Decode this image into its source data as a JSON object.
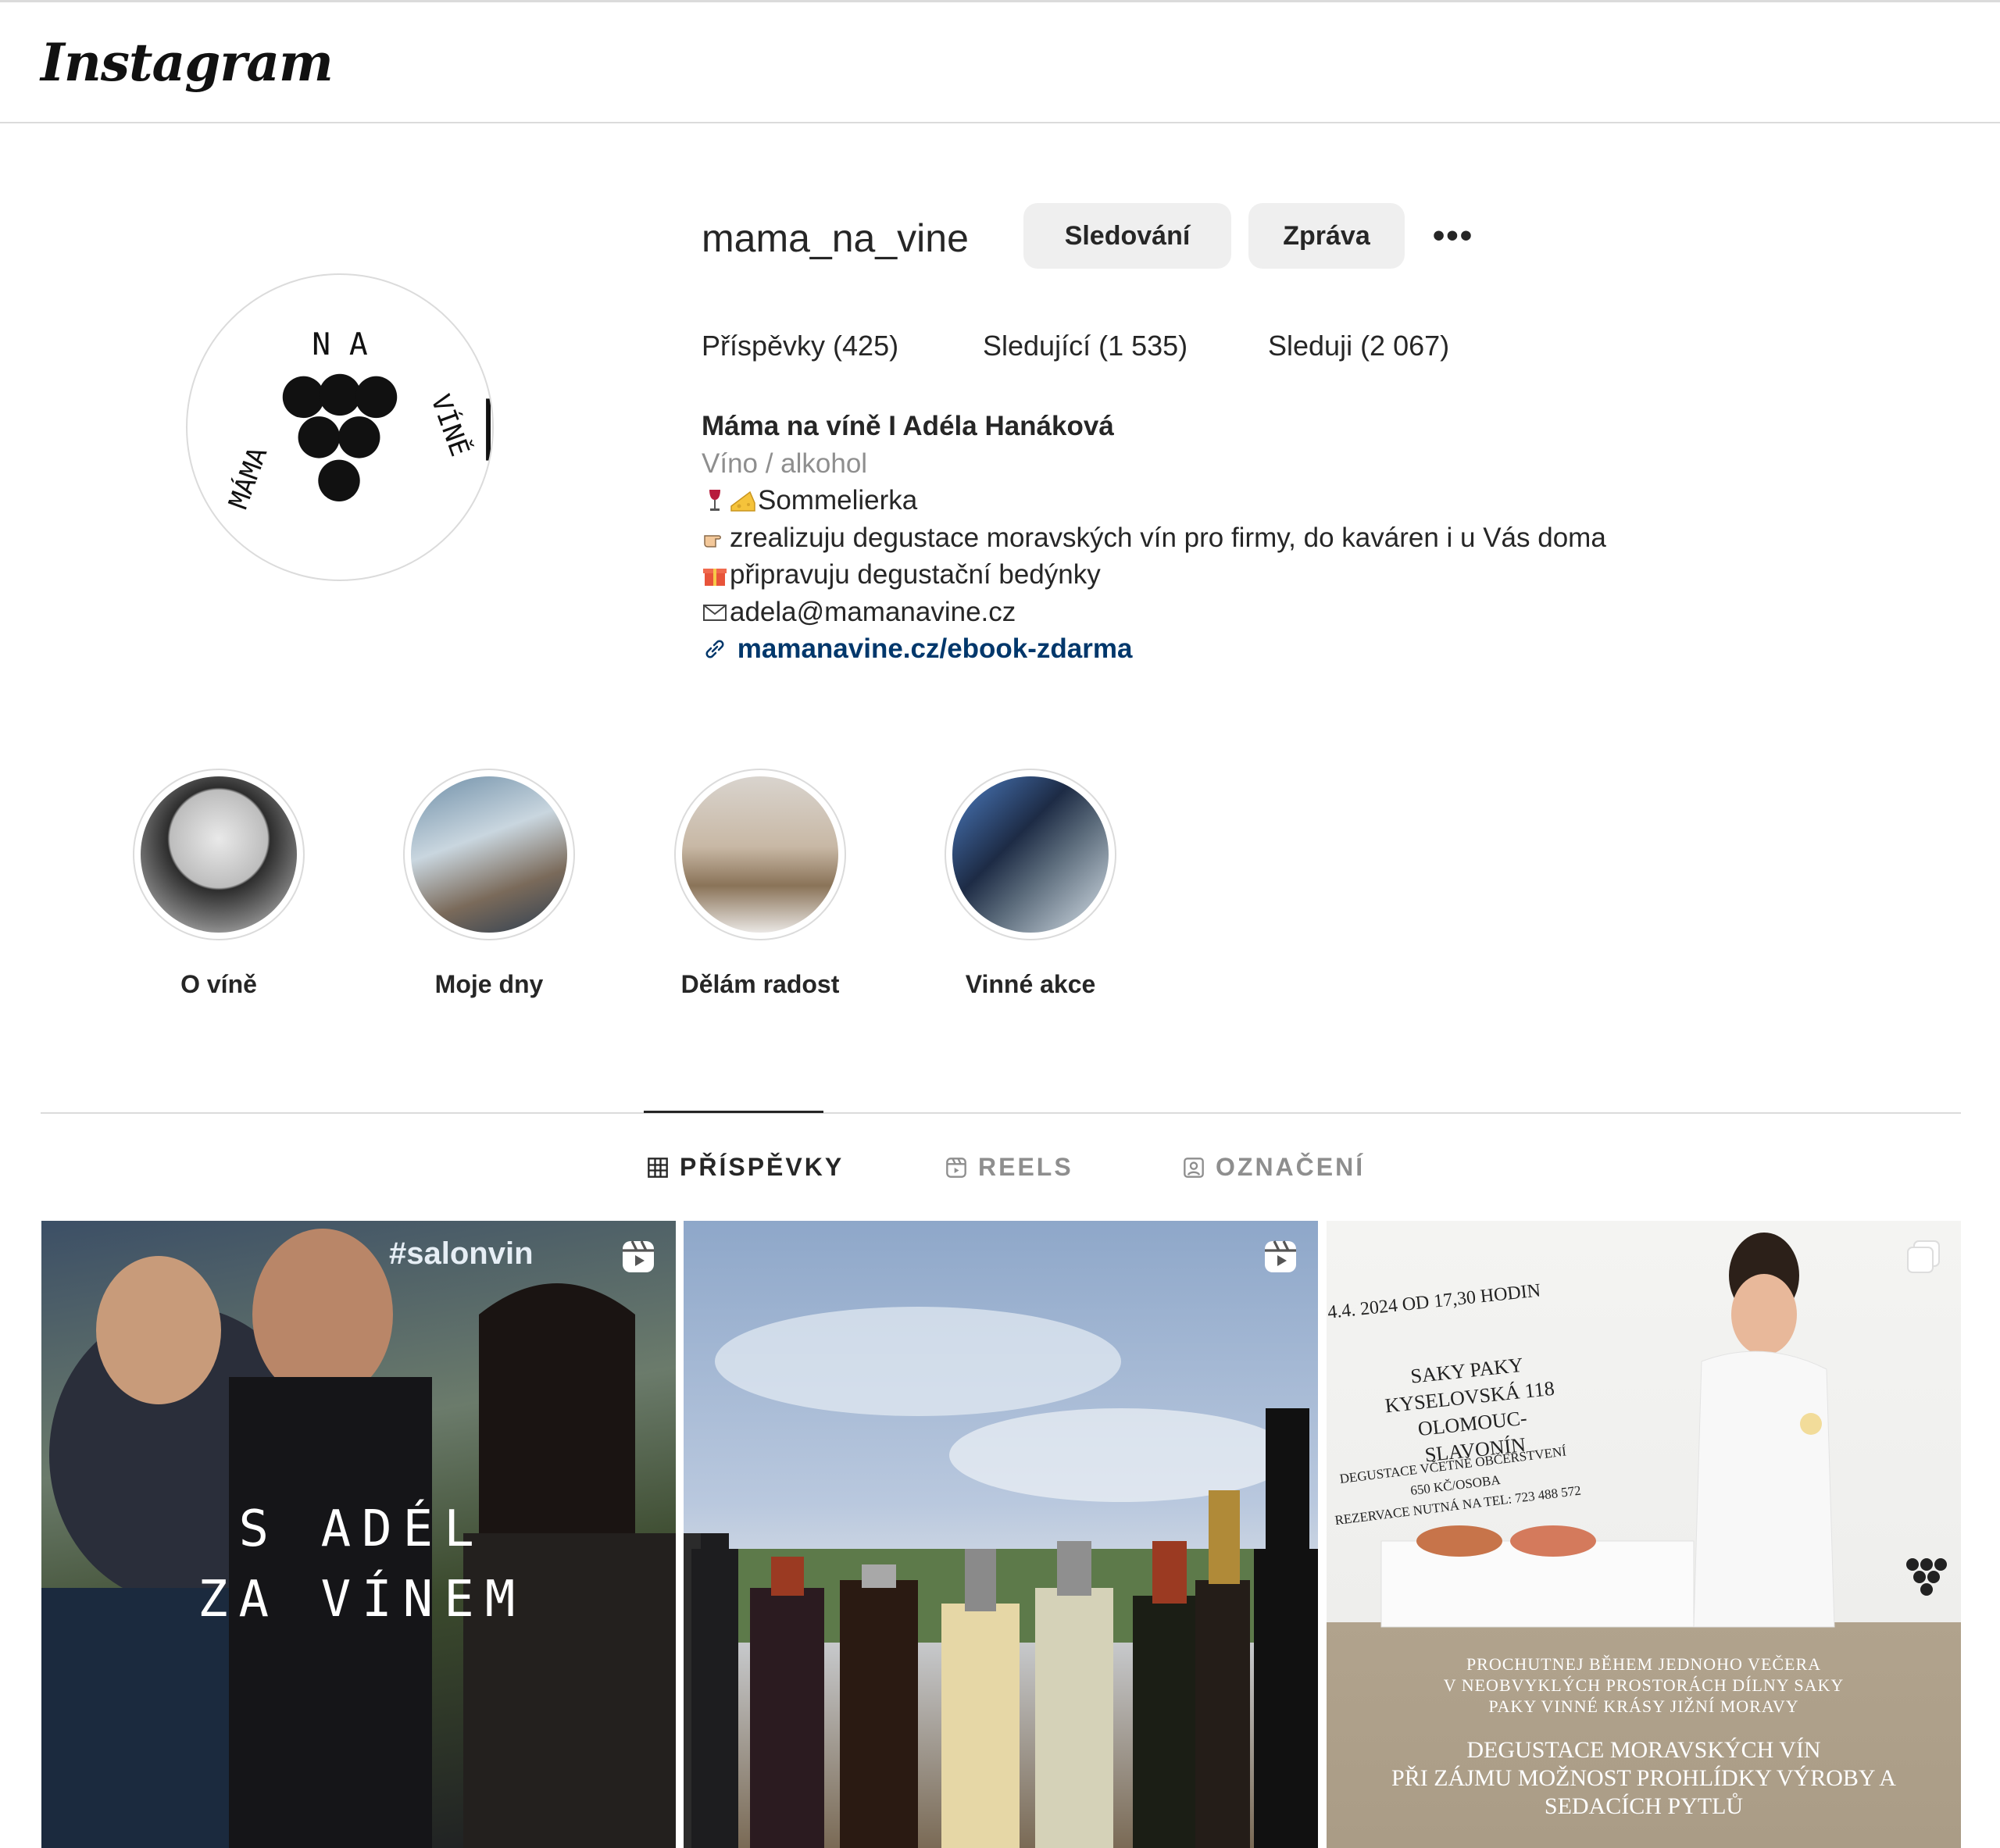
{
  "app": {
    "logo": "Instagram"
  },
  "profile": {
    "username": "mama_na_vine",
    "follow_button": "Sledování",
    "message_button": "Zpráva",
    "more_label": "•••",
    "stats": {
      "posts": "Příspěvky (425)",
      "followers": "Sledující (1 535)",
      "following": "Sleduji (2 067)"
    },
    "bio": {
      "name": "Máma na víně I Adéla Hanáková",
      "category": "Víno / alkohol",
      "line1": "Sommelierka",
      "line2": "zrealizuju degustace moravských vín pro firmy, do kaváren i u Vás doma",
      "line3": "připravuju degustační bedýnky",
      "line4": "adela@mamanavine.cz",
      "link": "mamanavine.cz/ebook-zdarma"
    },
    "avatar_letters": {
      "top": "N A",
      "left": "MÁMA",
      "right": "VÍNĚ"
    }
  },
  "highlights": [
    {
      "label": "O víně"
    },
    {
      "label": "Moje dny"
    },
    {
      "label": "Dělám radost"
    },
    {
      "label": "Vinné akce"
    }
  ],
  "tabs": [
    {
      "label": "PŘÍSPĚVKY",
      "icon": "grid-icon"
    },
    {
      "label": "REELS",
      "icon": "reels-icon"
    },
    {
      "label": "OZNAČENÍ",
      "icon": "tagged-icon"
    }
  ],
  "posts": [
    {
      "type": "reel",
      "overlay_tag": "#salonvin",
      "overlay_title_1": "S ADÉL",
      "overlay_title_2": "ZA VÍNEM"
    },
    {
      "type": "reel"
    },
    {
      "type": "carousel",
      "date": "4.4. 2024 OD 17,30 HODIN",
      "venue_1": "SAKY PAKY",
      "venue_2": "KYSELOVSKÁ 118",
      "venue_3": "OLOMOUC-SLAVONÍN",
      "price_1": "DEGUSTACE VČETNĚ OBČERSTVENÍ",
      "price_2": "650 KČ/OSOBA",
      "price_3": "REZERVACE NUTNÁ NA TEL: 723 488 572",
      "lower_1": "PROCHUTNEJ BĚHEM JEDNOHO VEČERA",
      "lower_2": "V NEOBVYKLÝCH PROSTORÁCH DÍLNY SAKY",
      "lower_3": "PAKY VINNÉ KRÁSY JIŽNÍ MORAVY",
      "lower_4": "DEGUSTACE MORAVSKÝCH VÍN",
      "lower_5": "PŘI ZÁJMU MOŽNOST PROHLÍDKY VÝROBY A",
      "lower_6": "SEDACÍCH PYTLŮ"
    }
  ]
}
